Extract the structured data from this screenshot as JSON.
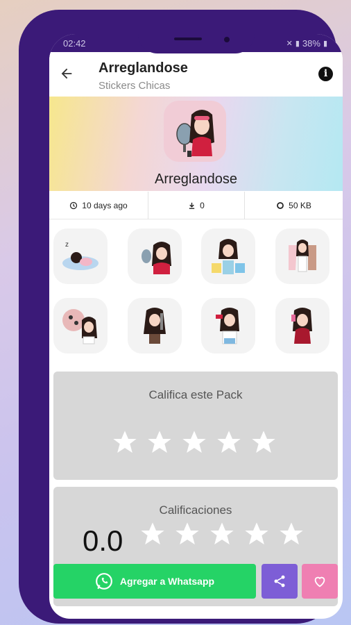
{
  "status": {
    "time": "02:42",
    "battery": "38%"
  },
  "appbar": {
    "title": "Arreglandose",
    "subtitle": "Stickers Chicas"
  },
  "pack": {
    "name": "Arreglandose"
  },
  "meta": {
    "age": "10 days ago",
    "downloads": "0",
    "size": "50 KB"
  },
  "stickers": [
    {
      "icon": "sleeping-girl-sticker"
    },
    {
      "icon": "mirror-makeup-sticker"
    },
    {
      "icon": "shopping-bags-sticker"
    },
    {
      "icon": "clothes-choice-sticker"
    },
    {
      "icon": "makeup-thoughts-sticker"
    },
    {
      "icon": "hair-straightener-sticker"
    },
    {
      "icon": "lipstick-sticker"
    },
    {
      "icon": "perfume-sticker"
    }
  ],
  "rate_card": {
    "title": "Califica este Pack",
    "stars": 5
  },
  "ratings_card": {
    "title": "Calificaciones",
    "score": "0.0",
    "stars": 5
  },
  "actions": {
    "add_label": "Agregar a Whatsapp"
  },
  "colors": {
    "frame": "#3b1a78",
    "whatsapp": "#25d366",
    "share": "#7d5ed6",
    "favorite": "#ef7fb2",
    "card": "#d7d7d7"
  }
}
